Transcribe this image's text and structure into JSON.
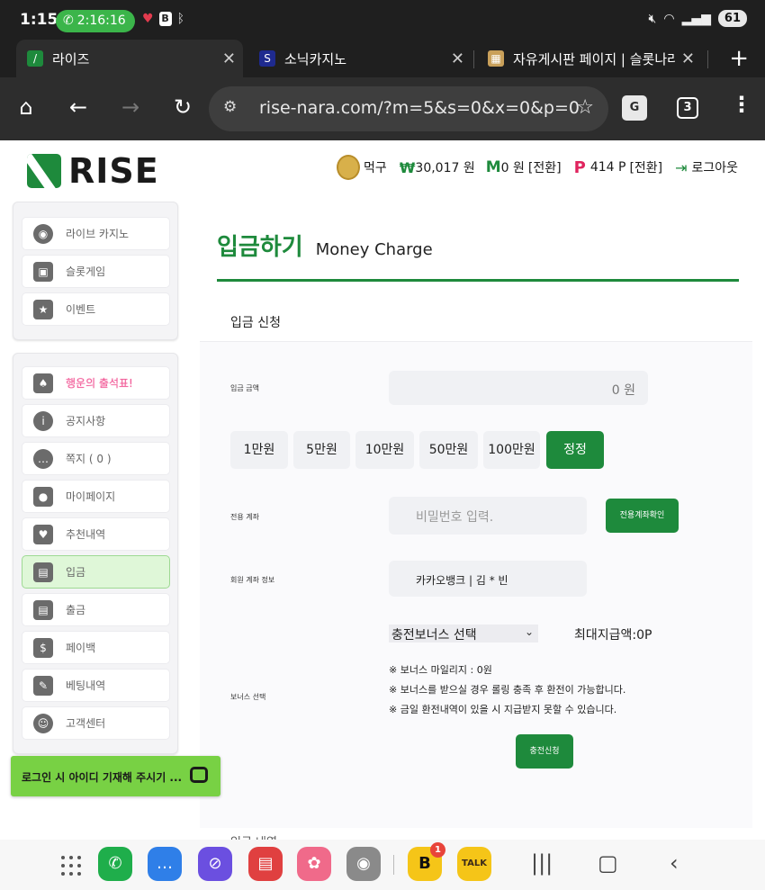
{
  "status_bar": {
    "time": "1:15",
    "call_timer": "2:16:16",
    "battery": "61"
  },
  "tabs": [
    {
      "title": "라이즈"
    },
    {
      "title": "소닉카지노"
    },
    {
      "title": "자유게시판 페이지 | 슬롯나라"
    }
  ],
  "toolbar": {
    "url": "rise-nara.com/?m=5&s=0&x=0&p=0",
    "tab_count": "3"
  },
  "header": {
    "logo_text": "RISE",
    "nickname": "먹구",
    "money_symbol": "₩",
    "money": "30,017 원",
    "mileage_symbol": "M",
    "mileage": "0 원",
    "mileage_convert": "[전환]",
    "points_symbol": "P",
    "points": "414 P",
    "points_convert": "[전환]",
    "logout": "로그아웃"
  },
  "sidebar": {
    "games": [
      {
        "label": "라이브 카지노",
        "icon": "casino-chips-icon"
      },
      {
        "label": "슬롯게임",
        "icon": "slot-machine-icon"
      },
      {
        "label": "이벤트",
        "icon": "star-badge-icon"
      }
    ],
    "menu": [
      {
        "label": "행운의 출석표!",
        "icon": "calendar-icon"
      },
      {
        "label": "공지사항",
        "icon": "info-icon"
      },
      {
        "label": "쪽지 ( 0 )",
        "icon": "message-icon"
      },
      {
        "label": "마이페이지",
        "icon": "user-icon"
      },
      {
        "label": "추천내역",
        "icon": "heart-icon"
      },
      {
        "label": "입금",
        "icon": "wallet-in-icon"
      },
      {
        "label": "출금",
        "icon": "wallet-out-icon"
      },
      {
        "label": "페이백",
        "icon": "coins-icon"
      },
      {
        "label": "베팅내역",
        "icon": "ticket-icon"
      },
      {
        "label": "고객센터",
        "icon": "support-icon"
      }
    ]
  },
  "main": {
    "title_ko": "입금하기",
    "title_en": "Money Charge",
    "section_title": "입금 신청",
    "amount_label": "입금 금액",
    "amount_value": "0  원",
    "chips": [
      "1만원",
      "5만원",
      "10만원",
      "50만원",
      "100만원",
      "정정"
    ],
    "account_label": "전용 계좌",
    "password_placeholder": "비밀번호 입력.",
    "account_check_button": "전용계좌확인",
    "member_account_label": "회원 계좌 정보",
    "member_account_value": "카카오뱅크 | 김 * 빈",
    "bonus_label": "보너스 선택",
    "bonus_select": "충전보너스 선택",
    "max_payout": "최대지급액:0P",
    "notes": [
      "※ 보너스 마일리지 : 0원",
      "※ 보너스를 받으실 경우 롤링 충족 후 환전이 가능합니다.",
      "※ 금일 환전내역이 있을 시 지급받지 못할 수 있습니다."
    ],
    "submit_button": "충전신청",
    "next_section_cut": "입금 내역"
  },
  "chat_banner": {
    "text": "로그인 시 아이디 기재해 주시기 ..."
  },
  "dock": {
    "badge_count": "1",
    "talk_label": "TALK"
  },
  "colors": {
    "brand_green": "#1e8a3c",
    "chat_green": "#78d144",
    "points_pink": "#e0245e"
  }
}
